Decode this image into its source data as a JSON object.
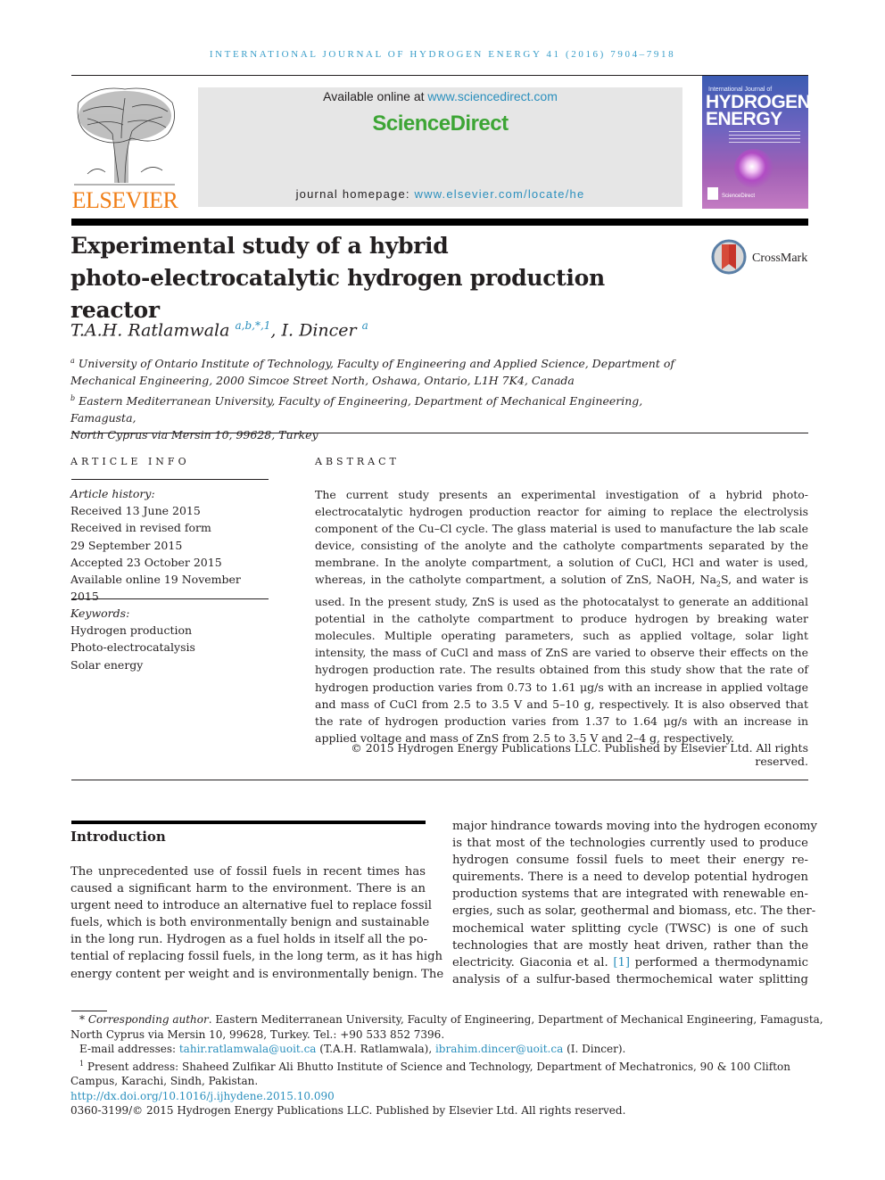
{
  "running_head": "INTERNATIONAL JOURNAL OF HYDROGEN ENERGY 41 (2016) 7904–7918",
  "publisher": {
    "logo_text": "ELSEVIER",
    "logo_icon": "elsevier-tree-icon",
    "brand_color": "#f07f18"
  },
  "sciencedirect": {
    "available_prefix": "Available online at ",
    "available_link": "www.sciencedirect.com",
    "brand": "ScienceDirect",
    "brand_color": "#3da535",
    "homepage_prefix": "journal homepage: ",
    "homepage_link": "www.elsevier.com/locate/he",
    "link_color": "#2a8fbd"
  },
  "journal_cover": {
    "top_line": "International Journal of",
    "title_line1": "HYDROGEN",
    "title_line2": "ENERGY",
    "footer": "ScienceDirect"
  },
  "article": {
    "title_line1": "Experimental study of a hybrid",
    "title_line2": "photo-electrocatalytic hydrogen production reactor",
    "crossmark_label": "CrossMark",
    "authors": [
      {
        "name": "T.A.H. Ratlamwala",
        "marks": "a,b,*,1"
      },
      {
        "name": "I. Dincer",
        "marks": "a"
      }
    ],
    "author_separator": ", ",
    "affiliations": [
      {
        "mark": "a",
        "line1": "University of Ontario Institute of Technology, Faculty of Engineering and Applied Science, Department of",
        "line2": "Mechanical Engineering, 2000 Simcoe Street North, Oshawa, Ontario, L1H 7K4, Canada"
      },
      {
        "mark": "b",
        "line1": "Eastern Mediterranean University, Faculty of Engineering, Department of Mechanical Engineering, Famagusta,",
        "line2": "North Cyprus via Mersin 10, 99628, Turkey"
      }
    ]
  },
  "article_info": {
    "heading": "ARTICLE INFO",
    "history_label": "Article history:",
    "history": [
      "Received 13 June 2015",
      "Received in revised form",
      "29 September 2015",
      "Accepted 23 October 2015",
      "Available online 19 November 2015"
    ],
    "keywords_label": "Keywords:",
    "keywords": [
      "Hydrogen production",
      "Photo-electrocatalysis",
      "Solar energy"
    ]
  },
  "abstract": {
    "heading": "ABSTRACT",
    "text_part1": "The current study presents an experimental investigation of a hybrid photo-electrocatalytic hydrogen production reactor for aiming to replace the electrolysis component of the Cu–Cl cycle. The glass material is used to manufacture the lab scale device, consisting of the anolyte and the catholyte compartments separated by the membrane. In the anolyte compartment, a solution of CuCl, HCl and water is used, whereas, in the catholyte compartment, a solution of ZnS, NaOH, Na",
    "subscript": "2",
    "text_part2": "S, and water is used. In the present study, ZnS is used as the photocatalyst to generate an additional potential in the catholyte compartment to produce hydrogen by breaking water molecules. Multiple operating parameters, such as applied voltage, solar light intensity, the mass of CuCl and mass of ZnS are varied to observe their effects on the hydrogen production rate. The results obtained from this study show that the rate of hydrogen production varies from 0.73 to 1.61 μg/s with an increase in applied voltage and mass of CuCl from 2.5 to 3.5 V and 5–10 g, respectively. It is also observed that the rate of hydrogen production varies from 1.37 to 1.64 μg/s with an increase in applied voltage and mass of ZnS from 2.5 to 3.5 V and 2–4 g, respectively.",
    "copyright": "© 2015 Hydrogen Energy Publications LLC. Published by Elsevier Ltd. All rights reserved."
  },
  "introduction": {
    "heading": "Introduction",
    "left_lines": [
      "The unprecedented use of fossil fuels in recent times has",
      "caused a significant harm to the environment. There is an",
      "urgent need to introduce an alternative fuel to replace fossil",
      "fuels, which is both environmentally benign and sustainable",
      "in the long run. Hydrogen as a fuel holds in itself all the po-",
      "tential of replacing fossil fuels, in the long term, as it has high",
      "energy content per weight and is environmentally benign. The"
    ],
    "right_lines": [
      "major hindrance towards moving into the hydrogen economy",
      "is that most of the technologies currently used to produce",
      "hydrogen consume fossil fuels to meet their energy re-",
      "quirements. There is a need to develop potential hydrogen",
      "production systems that are integrated with renewable en-",
      "ergies, such as solar, geothermal and biomass, etc. The ther-",
      "mochemical water splitting cycle (TWSC) is one of such",
      "technologies that are mostly heat driven, rather than the"
    ],
    "cite_line_prefix": "electricity. Giaconia et al. ",
    "cite_ref": "[1]",
    "cite_line_suffix": " performed a thermodynamic",
    "last_line": "analysis of a sulfur-based thermochemical water splitting"
  },
  "footnotes": {
    "corresponding_mark": "*",
    "corresponding_label": "Corresponding author",
    "corresponding_text": ". Eastern Mediterranean University, Faculty of Engineering, Department of Mechanical Engineering, Famagusta,",
    "corresponding_text2": "North Cyprus via Mersin 10, 99628, Turkey. Tel.: +90 533 852 7396.",
    "email_label": "E-mail addresses: ",
    "email1": "tahir.ratlamwala@uoit.ca",
    "email1_owner": " (T.A.H. Ratlamwala), ",
    "email2": "ibrahim.dincer@uoit.ca",
    "email2_owner": " (I. Dincer).",
    "present_mark": "1",
    "present_text": " Present address: Shaheed Zulfikar Ali Bhutto Institute of Science and Technology, Department of Mechatronics, 90 & 100 Clifton",
    "present_text2": "Campus, Karachi, Sindh, Pakistan.",
    "doi": "http://dx.doi.org/10.1016/j.ijhydene.2015.10.090",
    "issn_line": "0360-3199/© 2015 Hydrogen Energy Publications LLC. Published by Elsevier Ltd. All rights reserved."
  }
}
